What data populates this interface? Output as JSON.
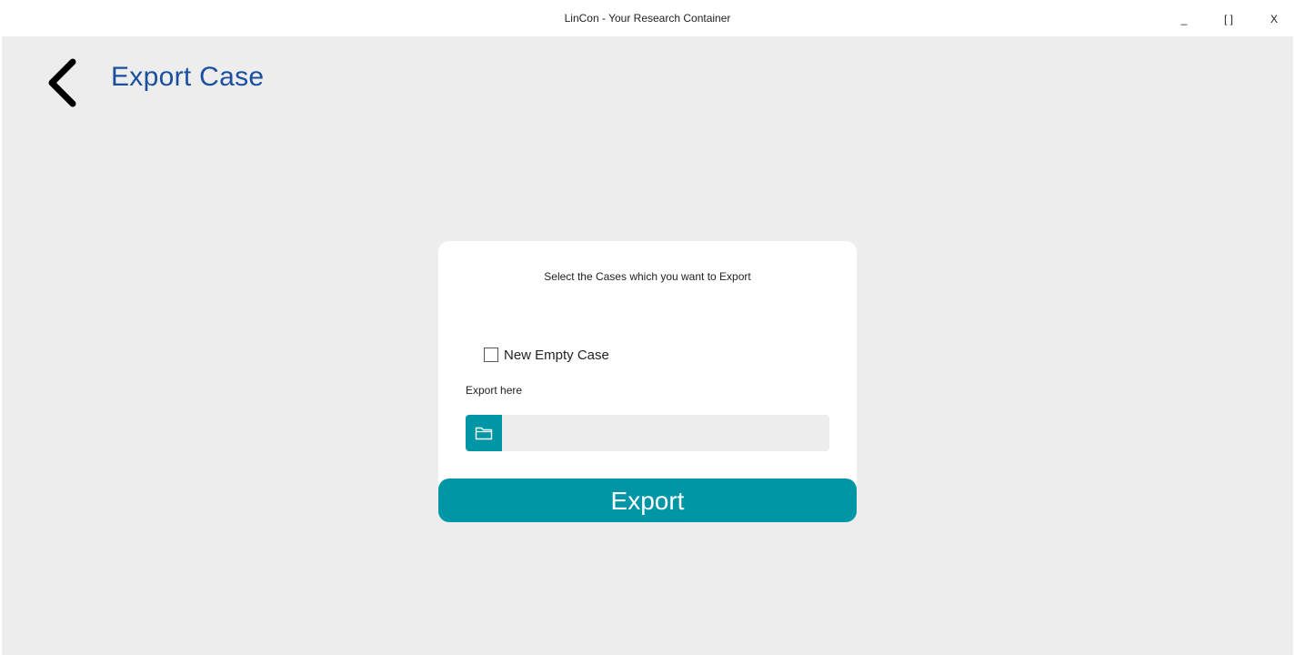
{
  "window": {
    "title": "LinCon - Your Research Container",
    "minimize_label": "_",
    "maximize_label": "[ ]",
    "close_label": "X"
  },
  "header": {
    "back_icon": "chevron-left-icon",
    "title": "Export Case"
  },
  "card": {
    "heading": "Select the Cases which you want to Export",
    "cases": [
      {
        "label": "New Empty Case",
        "checked": false
      }
    ],
    "export_label": "Export here",
    "folder_icon": "folder-icon",
    "path_value": ""
  },
  "actions": {
    "export_label": "Export"
  },
  "colors": {
    "accent": "#0096a6",
    "title": "#1a4fa0",
    "background": "#ededed",
    "card": "#ffffff"
  }
}
